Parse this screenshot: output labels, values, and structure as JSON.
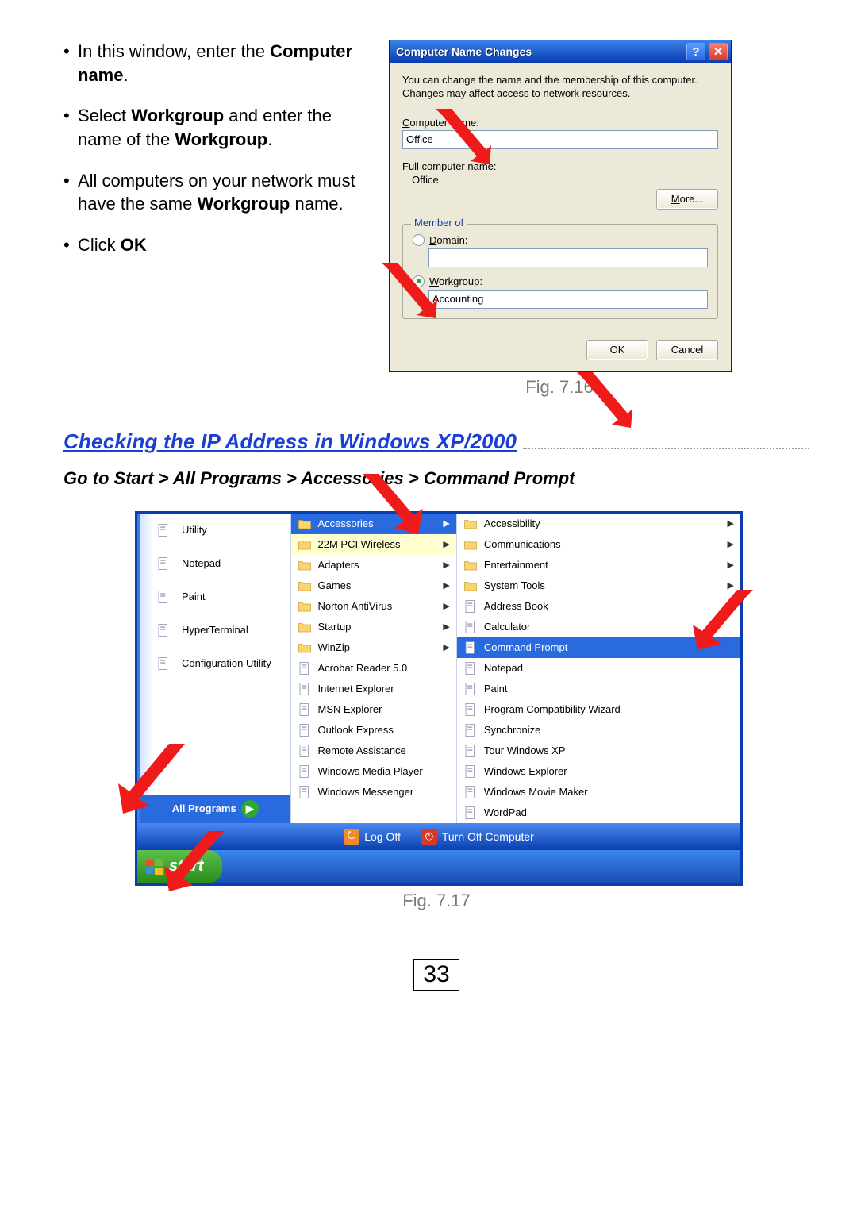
{
  "instructions": {
    "b1_pre": "In this window, enter the ",
    "b1_bold": "Computer name",
    "b1_post": ".",
    "b2_pre": "Select ",
    "b2_bold1": "Workgroup",
    "b2_mid": " and enter the name of the ",
    "b2_bold2": "Workgroup",
    "b2_post": ".",
    "b3_pre": "All computers on your network must have the same ",
    "b3_bold": "Workgroup",
    "b3_post": " name.",
    "b4_pre": "Click ",
    "b4_bold": "OK"
  },
  "dialog": {
    "title": "Computer Name Changes",
    "desc": "You can change the name and the membership of this computer. Changes may affect access to network resources.",
    "computer_name_label": "Computer name:",
    "computer_name_value": "Office",
    "full_name_label": "Full computer name:",
    "full_name_value": "Office",
    "more_label": "More...",
    "member_of": "Member of",
    "domain_label": "Domain:",
    "domain_value": "",
    "workgroup_label": "Workgroup:",
    "workgroup_value": "Accounting",
    "ok": "OK",
    "cancel": "Cancel"
  },
  "fig1": "Fig. 7.16",
  "section_title": "Checking the IP Address in Windows XP/2000",
  "sub_instruction": "Go to Start > All Programs > Accessories > Command Prompt",
  "startmenu": {
    "left": [
      "Utility",
      "Notepad",
      "Paint",
      "HyperTerminal",
      "Configuration Utility"
    ],
    "all_programs": "All Programs",
    "mid": [
      "Accessories",
      "22M PCI Wireless",
      "Adapters",
      "Games",
      "Norton AntiVirus",
      "Startup",
      "WinZip",
      "Acrobat Reader 5.0",
      "Internet Explorer",
      "MSN Explorer",
      "Outlook Express",
      "Remote Assistance",
      "Windows Media Player",
      "Windows Messenger"
    ],
    "right": [
      "Accessibility",
      "Communications",
      "Entertainment",
      "System Tools",
      "Address Book",
      "Calculator",
      "Command Prompt",
      "Notepad",
      "Paint",
      "Program Compatibility Wizard",
      "Synchronize",
      "Tour Windows XP",
      "Windows Explorer",
      "Windows Movie Maker",
      "WordPad"
    ],
    "logoff": "Log Off",
    "turnoff": "Turn Off Computer",
    "start": "start"
  },
  "fig2": "Fig. 7.17",
  "pagenum": "33"
}
